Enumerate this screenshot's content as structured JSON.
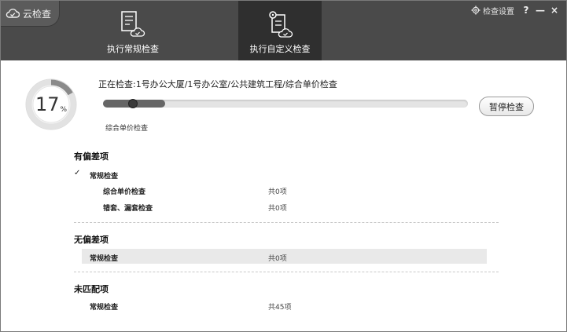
{
  "app": {
    "name": "云检查"
  },
  "toolbar": {
    "routine_label": "执行常规检查",
    "custom_label": "执行自定义检查"
  },
  "window_controls": {
    "settings_label": "检查设置",
    "help": "?",
    "minimize": "—",
    "close": "×"
  },
  "progress": {
    "percent_value": "17",
    "percent_unit": "%",
    "fraction": 0.17,
    "current_path": "正在检查:1号办公大厦/1号办公室/公共建筑工程/综合单价检查",
    "current_item": "综合单价检查",
    "pause_label": "暂停检查"
  },
  "results": {
    "deviation": {
      "title": "有偏差项",
      "group": "常规检查",
      "items": [
        {
          "name": "综合单价检查",
          "count": "共0项"
        },
        {
          "name": "错套、漏套检查",
          "count": "共0项"
        }
      ]
    },
    "no_deviation": {
      "title": "无偏差项",
      "group": "常规检查",
      "count": "共0项"
    },
    "unmatched": {
      "title": "未匹配项",
      "group": "常规检查",
      "count": "共45项"
    }
  },
  "colors": {
    "toolbar_bg": "#4a4a4a",
    "toolbar_selected": "#2f2f2f",
    "ring_progress": "#8a8a8a"
  }
}
